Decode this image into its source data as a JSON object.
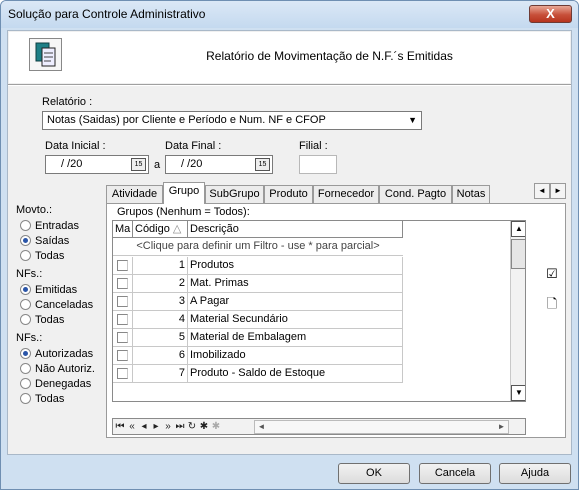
{
  "window": {
    "title": "Solução para Controle Administrativo",
    "close_label": "X"
  },
  "header": {
    "title": "Relatório de Movimentação de N.F.´s Emitidas",
    "logo_icon": "report-document-icon"
  },
  "relatorio": {
    "label": "Relatório :",
    "value": "Notas (Saidas) por Cliente e Período e Num. NF e CFOP"
  },
  "dates": {
    "inicial_label": "Data Inicial :",
    "inicial_value": "/    /20",
    "a_label": "a",
    "final_label": "Data Final :",
    "final_value": "/    /20",
    "calendar_label": "15"
  },
  "filial": {
    "label": "Filial :",
    "value": ""
  },
  "movto": {
    "label": "Movto.:",
    "options": [
      "Entradas",
      "Saídas",
      "Todas"
    ],
    "selected": 1
  },
  "nfs1": {
    "label": "NFs.:",
    "options": [
      "Emitidas",
      "Canceladas",
      "Todas"
    ],
    "selected": 0
  },
  "nfs2": {
    "label": "NFs.:",
    "options": [
      "Autorizadas",
      "Não Autoriz.",
      "Denegadas",
      "Todas"
    ],
    "selected": 0
  },
  "tabs": [
    "Atividade",
    "Grupo",
    "SubGrupo",
    "Produto",
    "Fornecedor",
    "Cond. Pagto",
    "Notas"
  ],
  "active_tab": 1,
  "grid": {
    "caption": "Grupos (Nenhum = Todos):",
    "columns": [
      "Ma",
      "Código",
      "Descrição"
    ],
    "filter_hint": "<Clique para definir um Filtro - use * para parcial>",
    "rows": [
      {
        "code": "1",
        "desc": "Produtos"
      },
      {
        "code": "2",
        "desc": "Mat. Primas"
      },
      {
        "code": "3",
        "desc": "A Pagar"
      },
      {
        "code": "4",
        "desc": "Material Secundário"
      },
      {
        "code": "5",
        "desc": "Material de Embalagem"
      },
      {
        "code": "6",
        "desc": "Imobilizado"
      },
      {
        "code": "7",
        "desc": "Produto - Saldo de Estoque"
      }
    ]
  },
  "buttons": {
    "ok": "OK",
    "cancel": "Cancela",
    "help": "Ajuda"
  },
  "colors": {
    "title_bar": "#c4d9ef",
    "close_button": "#c7503a",
    "radio_dot": "#2a55a8"
  }
}
